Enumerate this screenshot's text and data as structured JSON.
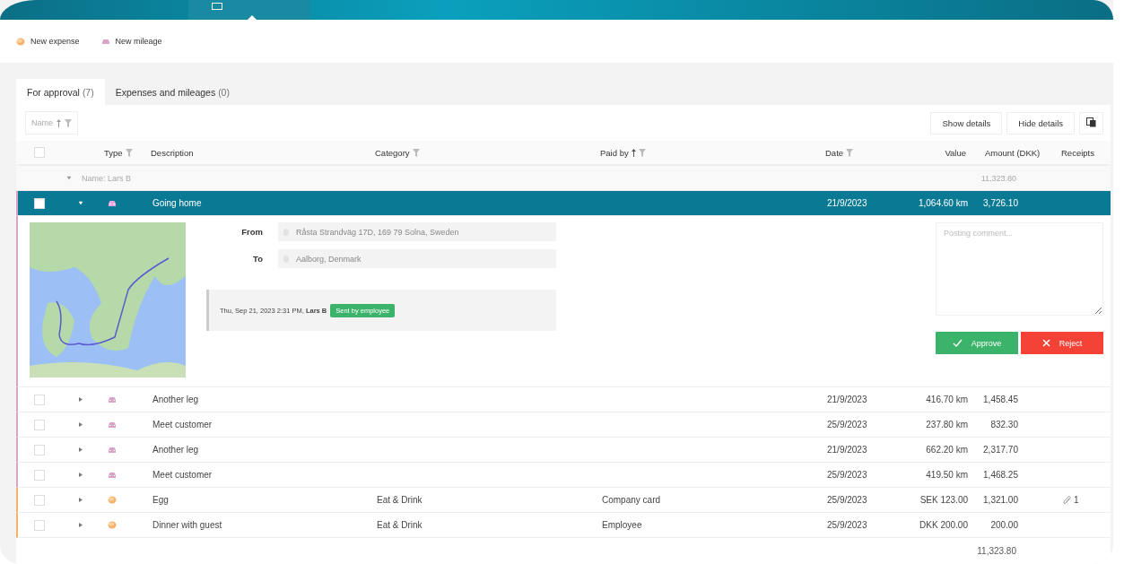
{
  "toolbar": {
    "actions": [
      {
        "kind": "expense",
        "label": "New expense"
      },
      {
        "kind": "mileage",
        "label": "New mileage"
      }
    ]
  },
  "tabs": [
    {
      "label": "For approval",
      "count": "(7)",
      "selected": true
    },
    {
      "label": "Expenses and mileages",
      "count": "(0)",
      "selected": false
    }
  ],
  "group_chip": {
    "label": "Name"
  },
  "detail_buttons": [
    "Show details",
    "Hide details"
  ],
  "columns": [
    {
      "label": "Type",
      "filter": true,
      "sort": false
    },
    {
      "label": "Description",
      "filter": false,
      "sort": false
    },
    {
      "label": "Category",
      "filter": true,
      "sort": false
    },
    {
      "label": "Paid by",
      "filter": true,
      "sort": true
    },
    {
      "label": "Date",
      "filter": true,
      "sort": false
    },
    {
      "label": "Value",
      "filter": false,
      "sort": false
    },
    {
      "label": "Amount (DKK)",
      "filter": false,
      "sort": false
    },
    {
      "label": "Receipts",
      "filter": false,
      "sort": false
    }
  ],
  "select_all": {
    "checked": false
  },
  "group": {
    "label": "Name: Lars B",
    "expanded": true,
    "total": "11,323.80"
  },
  "rows": [
    {
      "kind": "mileage",
      "description": "Going home",
      "date": "21/9/2023",
      "value": "1,064.60 km",
      "amount": "3,726.10",
      "selected": true,
      "expanded": true,
      "checked": false,
      "details": {
        "from_label": "From",
        "from": "Råsta Strandväg 17D, 169 79 Solna, Sweden",
        "to_label": "To",
        "to": "Aalborg, Denmark",
        "log_time": "Thu, Sep 21, 2023 2:31 PM,",
        "log_author": "Lars B",
        "log_status": "Sent by employee",
        "comment_placeholder": "Posting comment...",
        "approve": "Approve",
        "reject": "Reject"
      }
    },
    {
      "kind": "mileage",
      "description": "Another leg",
      "date": "21/9/2023",
      "value": "416.70 km",
      "amount": "1,458.45",
      "selected": false,
      "expanded": false,
      "checked": false
    },
    {
      "kind": "mileage",
      "description": "Meet customer",
      "date": "25/9/2023",
      "value": "237.80 km",
      "amount": "832.30",
      "selected": false,
      "expanded": false,
      "checked": false
    },
    {
      "kind": "mileage",
      "description": "Another leg",
      "date": "21/9/2023",
      "value": "662.20 km",
      "amount": "2,317.70",
      "selected": false,
      "expanded": false,
      "checked": false
    },
    {
      "kind": "mileage",
      "description": "Meet customer",
      "date": "25/9/2023",
      "value": "419.50 km",
      "amount": "1,468.25",
      "selected": false,
      "expanded": false,
      "checked": false
    },
    {
      "kind": "expense",
      "description": "Egg",
      "category": "Eat & Drink",
      "paid_by": "Company card",
      "date": "25/9/2023",
      "value": "SEK 123.00",
      "amount": "1,321.00",
      "receipts": "1",
      "selected": false,
      "expanded": false,
      "checked": false
    },
    {
      "kind": "expense",
      "description": "Dinner with guest",
      "category": "Eat & Drink",
      "paid_by": "Employee",
      "date": "25/9/2023",
      "value": "DKK 200.00",
      "amount": "200.00",
      "selected": false,
      "expanded": false,
      "checked": false
    }
  ],
  "footer_total": "11,323.80"
}
